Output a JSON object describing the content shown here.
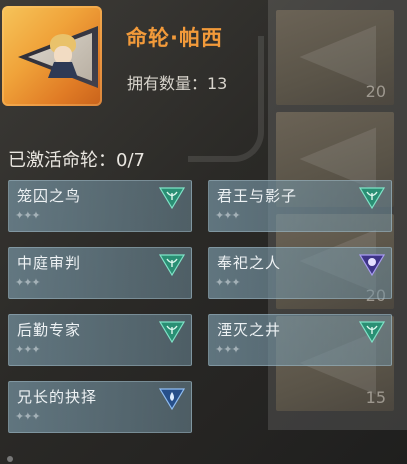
{
  "header": {
    "title": "命轮·帕西",
    "owned_label": "拥有数量：13",
    "activated_label": "已激活命轮：0/7"
  },
  "side_items": [
    {
      "count": "20"
    },
    {
      "count": ""
    },
    {
      "count": ""
    },
    {
      "count": "20"
    },
    {
      "count": "15"
    }
  ],
  "constellations": [
    {
      "name": "笼囚之鸟",
      "stars": "✦✦✦",
      "badge": "green"
    },
    {
      "name": "君王与影子",
      "stars": "✦✦✦",
      "badge": "green"
    },
    {
      "name": "中庭审判",
      "stars": "✦✦✦",
      "badge": "green"
    },
    {
      "name": "奉祀之人",
      "stars": "✦✦✦",
      "badge": "purple"
    },
    {
      "name": "后勤专家",
      "stars": "✦✦✦",
      "badge": "green"
    },
    {
      "name": "湮灭之井",
      "stars": "✦✦✦",
      "badge": "green"
    },
    {
      "name": "兄长的抉择",
      "stars": "✦✦✦",
      "badge": "blue"
    }
  ],
  "colors": {
    "title": "#f29a3a",
    "badge_green": "#3fbf9a",
    "badge_purple": "#6a5bc8",
    "badge_blue": "#3a78c8"
  }
}
